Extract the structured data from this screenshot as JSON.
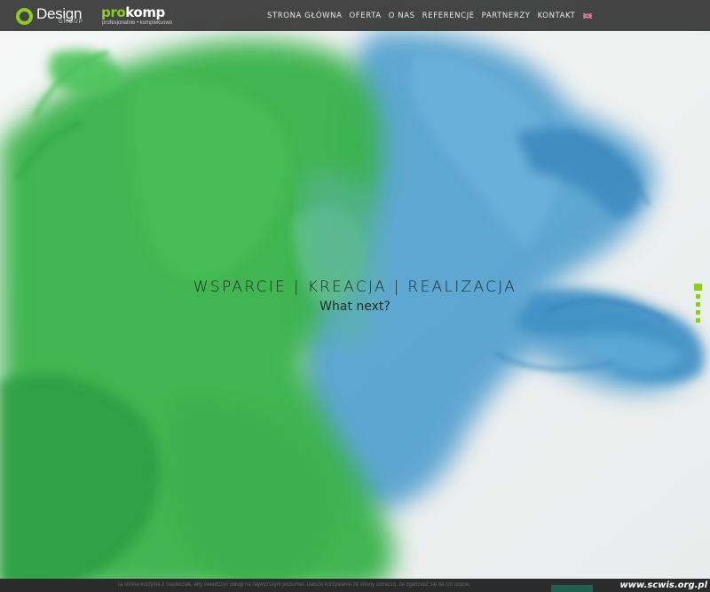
{
  "header": {
    "logo_design": {
      "word": "Design",
      "sub": "GROUP"
    },
    "logo_prokomp": {
      "pro": "pro",
      "komp": "komp",
      "tagline": "profesjonalnie • kompleksowo"
    },
    "nav": [
      {
        "label": "STRONA GŁÓWNA"
      },
      {
        "label": "OFERTA"
      },
      {
        "label": "O NAS"
      },
      {
        "label": "REFERENCJE"
      },
      {
        "label": "PARTNERZY"
      },
      {
        "label": "KONTAKT"
      }
    ],
    "language_flag": "uk-flag-icon"
  },
  "hero": {
    "headline": "WSPARCIE | KREACJA | REALIZACJA",
    "subheadline": "What next?",
    "slide_dots": 6,
    "active_slide": 1
  },
  "cookie_bar": {
    "text": "Ta strona korzysta z ciasteczek, aby świadczyć usługi na najwyższym poziomie. Dalsze korzystanie ze strony oznacza, że zgadzasz się na ich użycie."
  },
  "watermark": "www.scwis.org.pl",
  "colors": {
    "accent": "#8ccd1e",
    "header_bg": "#373737",
    "green_ink": "#33b54a",
    "blue_ink": "#4a9ed0"
  }
}
